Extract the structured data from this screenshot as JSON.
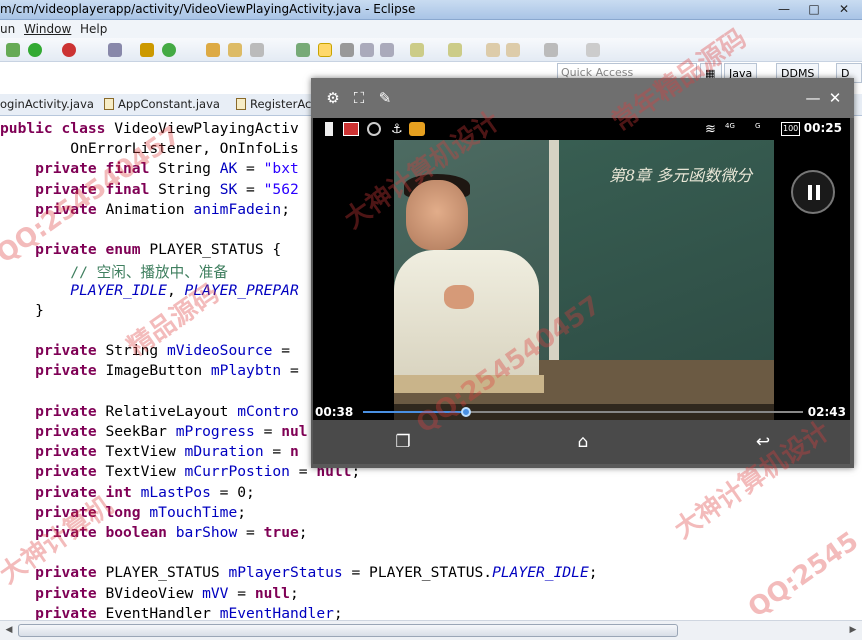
{
  "window": {
    "title": "m/cm/videoplayerapp/activity/VideoViewPlayingActivity.java - Eclipse",
    "minimize": "—",
    "maximize": "□",
    "close": "✕"
  },
  "menu": [
    "un",
    "Window",
    "Help"
  ],
  "quick_access": {
    "placeholder": "Quick Access"
  },
  "perspectives": [
    "Java",
    "DDMS",
    "D"
  ],
  "tabs": [
    "oginActivity.java",
    "AppConstant.java",
    "RegisterActi"
  ],
  "code": {
    "lines": [
      [
        [
          "kw",
          "public class "
        ],
        [
          "n",
          "VideoViewPlayingActiv"
        ]
      ],
      [
        [
          "n",
          "        OnErrorListener, OnInfoLis"
        ]
      ],
      [
        [
          "n",
          "    "
        ],
        [
          "kw",
          "private final "
        ],
        [
          "n",
          "String "
        ],
        [
          "fld",
          "AK"
        ],
        [
          "n",
          " = "
        ],
        [
          "str",
          "\"bxt"
        ]
      ],
      [
        [
          "n",
          "    "
        ],
        [
          "kw",
          "private final "
        ],
        [
          "n",
          "String "
        ],
        [
          "fld",
          "SK"
        ],
        [
          "n",
          " = "
        ],
        [
          "str",
          "\"562"
        ]
      ],
      [
        [
          "n",
          "    "
        ],
        [
          "kw",
          "private "
        ],
        [
          "n",
          "Animation "
        ],
        [
          "fld",
          "animFadein"
        ],
        [
          "n",
          ";"
        ]
      ],
      [
        [
          "n",
          ""
        ]
      ],
      [
        [
          "n",
          "    "
        ],
        [
          "kw",
          "private enum "
        ],
        [
          "n",
          "PLAYER_STATUS {"
        ]
      ],
      [
        [
          "n",
          "        "
        ],
        [
          "cmt",
          "// 空闲、播放中、准备"
        ]
      ],
      [
        [
          "n",
          "        "
        ],
        [
          "cnst",
          "PLAYER_IDLE"
        ],
        [
          "n",
          ", "
        ],
        [
          "cnst",
          "PLAYER_PREPAR"
        ]
      ],
      [
        [
          "n",
          "    }"
        ]
      ],
      [
        [
          "n",
          ""
        ]
      ],
      [
        [
          "n",
          "    "
        ],
        [
          "kw",
          "private "
        ],
        [
          "n",
          "String "
        ],
        [
          "fld",
          "mVideoSource"
        ],
        [
          "n",
          " ="
        ]
      ],
      [
        [
          "n",
          "    "
        ],
        [
          "kw",
          "private "
        ],
        [
          "n",
          "ImageButton "
        ],
        [
          "fld",
          "mPlaybtn"
        ],
        [
          "n",
          " ="
        ]
      ],
      [
        [
          "n",
          ""
        ]
      ],
      [
        [
          "n",
          "    "
        ],
        [
          "kw",
          "private "
        ],
        [
          "n",
          "RelativeLayout "
        ],
        [
          "fld",
          "mContro"
        ]
      ],
      [
        [
          "n",
          "    "
        ],
        [
          "kw",
          "private "
        ],
        [
          "n",
          "SeekBar "
        ],
        [
          "fld",
          "mProgress"
        ],
        [
          "n",
          " = "
        ],
        [
          "kw",
          "nul"
        ]
      ],
      [
        [
          "n",
          "    "
        ],
        [
          "kw",
          "private "
        ],
        [
          "n",
          "TextView "
        ],
        [
          "fld",
          "mDuration"
        ],
        [
          "n",
          " = "
        ],
        [
          "kw",
          "n"
        ]
      ],
      [
        [
          "n",
          "    "
        ],
        [
          "kw",
          "private "
        ],
        [
          "n",
          "TextView "
        ],
        [
          "fld",
          "mCurrPostion"
        ],
        [
          "n",
          " = "
        ],
        [
          "kw",
          "null"
        ],
        [
          "n",
          ";"
        ]
      ],
      [
        [
          "n",
          "    "
        ],
        [
          "kw",
          "private int "
        ],
        [
          "fld",
          "mLastPos"
        ],
        [
          "n",
          " = 0;"
        ]
      ],
      [
        [
          "n",
          "    "
        ],
        [
          "kw",
          "private long "
        ],
        [
          "fld",
          "mTouchTime"
        ],
        [
          "n",
          ";"
        ]
      ],
      [
        [
          "n",
          "    "
        ],
        [
          "kw",
          "private boolean "
        ],
        [
          "fld",
          "barShow"
        ],
        [
          "n",
          " = "
        ],
        [
          "kw",
          "true"
        ],
        [
          "n",
          ";"
        ]
      ],
      [
        [
          "n",
          ""
        ]
      ],
      [
        [
          "n",
          "    "
        ],
        [
          "kw",
          "private "
        ],
        [
          "n",
          "PLAYER_STATUS "
        ],
        [
          "fld",
          "mPlayerStatus"
        ],
        [
          "n",
          " = PLAYER_STATUS."
        ],
        [
          "cnst",
          "PLAYER_IDLE"
        ],
        [
          "n",
          ";"
        ]
      ],
      [
        [
          "n",
          "    "
        ],
        [
          "kw",
          "private "
        ],
        [
          "n",
          "BVideoView "
        ],
        [
          "fld",
          "mVV"
        ],
        [
          "n",
          " = "
        ],
        [
          "kw",
          "null"
        ],
        [
          "n",
          ";"
        ]
      ],
      [
        [
          "n",
          "    "
        ],
        [
          "kw",
          "private "
        ],
        [
          "n",
          "EventHandler "
        ],
        [
          "fld",
          "mEventHandler"
        ],
        [
          "n",
          ";"
        ]
      ]
    ]
  },
  "emulator": {
    "status_time": "00:25",
    "battery": "100",
    "signal_4g": "4G",
    "signal_g": "G",
    "board_text": "第8章 多元函数微分",
    "current_time": "00:38",
    "duration": "02:43",
    "progress": 0.233
  },
  "watermarks": [
    "QQ:254540457",
    "大神计算机设计",
    "精品源码",
    "QQ:254540457",
    "大神计算机",
    "常年精品源码",
    "QQ:2545",
    "大神计算机设计"
  ],
  "colors": {
    "keyword": "#7f0055",
    "field": "#0000c0",
    "comment": "#3f7f5f",
    "string": "#2a00ff",
    "accent": "#4a90e2"
  }
}
